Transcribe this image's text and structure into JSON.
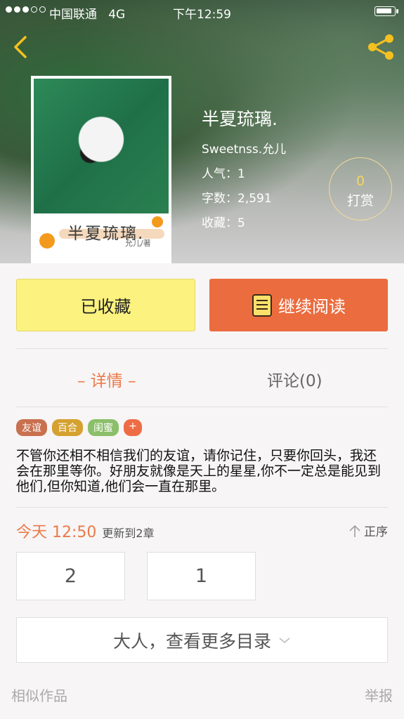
{
  "status_bar": {
    "carrier": "中国联通",
    "network": "4G",
    "time": "下午12:59"
  },
  "book": {
    "title": "半夏琉璃.",
    "author": "Sweetnss.允儿",
    "popularity": "人气：1",
    "word_count": "字数：2,591",
    "favorites": "收藏：5",
    "cover_title": "半夏琉璃.",
    "cover_author": "允儿/著"
  },
  "tip": {
    "count": "0",
    "label": "打赏"
  },
  "actions": {
    "favorited": "已收藏",
    "continue_reading": "继续阅读"
  },
  "tabs": {
    "detail": "– 详情 –",
    "comments": "评论(0)"
  },
  "tags": [
    {
      "label": "友谊",
      "color": "#c9704f"
    },
    {
      "label": "百合",
      "color": "#d5a12f"
    },
    {
      "label": "闺蜜",
      "color": "#8bbf6a"
    },
    {
      "label": "+",
      "color": "#ee6c45"
    }
  ],
  "description": "不管你还相不相信我们的友谊，请你记住，只要你回头，我还会在那里等你。好朋友就像是天上的星星,你不一定总是能见到他们,但你知道,他们会一直在那里。",
  "update": {
    "time": "今天 12:50",
    "text": "更新到2章",
    "order": "正序"
  },
  "chapters": [
    "2",
    "1"
  ],
  "more_catalog": "大人，查看更多目录",
  "footer": {
    "similar": "相似作品",
    "report": "举报"
  }
}
